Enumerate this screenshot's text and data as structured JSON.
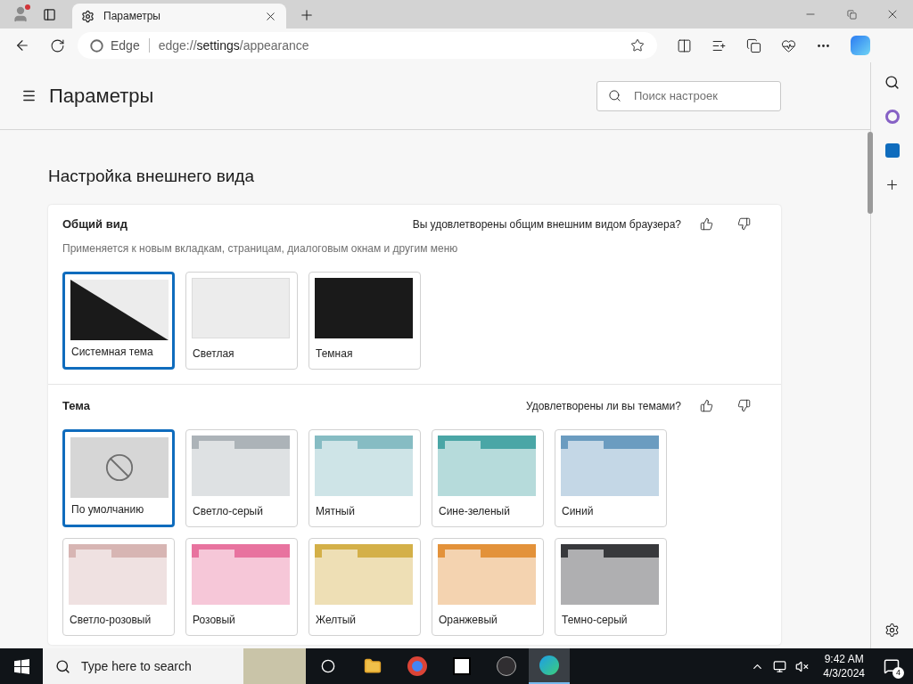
{
  "tab": {
    "title": "Параметры"
  },
  "address_bar": {
    "site_label": "Edge",
    "url_prefix": "edge://",
    "url_host": "settings",
    "url_path": "/appearance"
  },
  "header": {
    "title": "Параметры",
    "search": {
      "placeholder": "Поиск настроек"
    }
  },
  "page_title": "Настройка внешнего вида",
  "overall": {
    "title": "Общий вид",
    "feedback": "Вы удовлетворены общим внешним видом браузера?",
    "description": "Применяется к новым вкладкам, страницам, диалоговым окнам и другим меню",
    "options": [
      {
        "kind": "system",
        "label": "Системная тема",
        "selected": true
      },
      {
        "kind": "light",
        "label": "Светлая",
        "selected": false
      },
      {
        "kind": "dark",
        "label": "Темная",
        "selected": false
      }
    ]
  },
  "themes": {
    "title": "Тема",
    "feedback": "Удовлетворены ли вы темами?",
    "items": [
      {
        "kind": "default",
        "label": "По умолчанию",
        "selected": true
      },
      {
        "kind": "folder",
        "label": "Светло-серый",
        "selected": false,
        "color": "#acb3b8"
      },
      {
        "kind": "folder",
        "label": "Мятный",
        "selected": false,
        "color": "#86bcc3"
      },
      {
        "kind": "folder",
        "label": "Сине-зеленый",
        "selected": false,
        "color": "#4aa6a6"
      },
      {
        "kind": "folder",
        "label": "Синий",
        "selected": false,
        "color": "#6b9cc0"
      },
      {
        "kind": "folder",
        "label": "Светло-розовый",
        "selected": false,
        "color": "#d7b5b3"
      },
      {
        "kind": "folder",
        "label": "Розовый",
        "selected": false,
        "color": "#e8739f"
      },
      {
        "kind": "folder",
        "label": "Желтый",
        "selected": false,
        "color": "#d4b048"
      },
      {
        "kind": "folder",
        "label": "Оранжевый",
        "selected": false,
        "color": "#e3923a"
      },
      {
        "kind": "folder",
        "label": "Темно-серый",
        "selected": false,
        "color": "#38393c"
      }
    ]
  },
  "taskbar": {
    "search_placeholder": "Type here to search",
    "time": "9:42 AM",
    "date": "4/3/2024",
    "notifications": "4"
  }
}
